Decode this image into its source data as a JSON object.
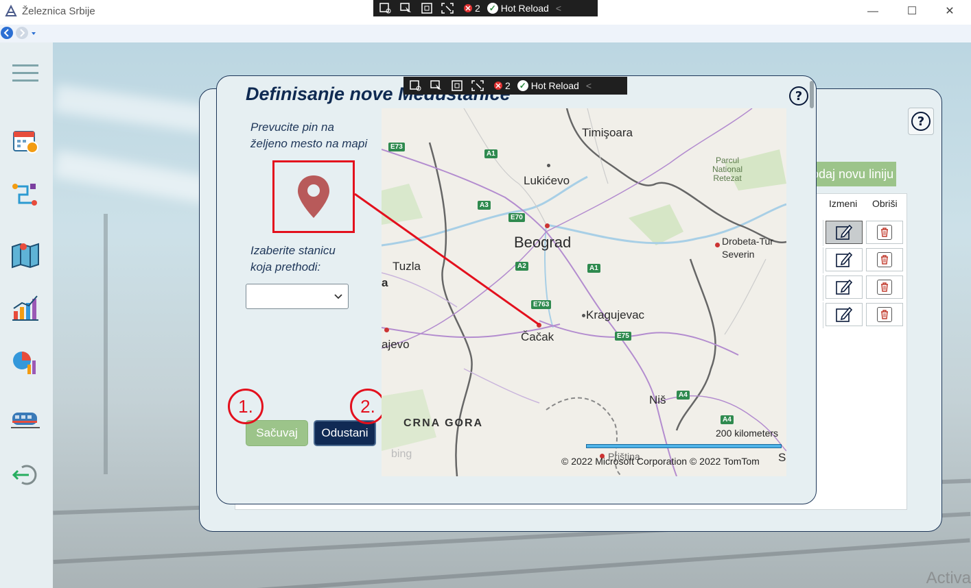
{
  "window": {
    "title": "Železnica Srbije",
    "minimize": "—",
    "maximize": "☐",
    "close": "✕"
  },
  "devbar": {
    "errors": "2",
    "hot_reload": "Hot Reload",
    "collapse": "<"
  },
  "sidebar": {
    "items": [
      "menu-icon",
      "calendar-icon",
      "routes-icon",
      "map-icon",
      "chart-icon",
      "pie-chart-icon",
      "train-icon",
      "logout-icon"
    ]
  },
  "background": {
    "add_line_label": "Dodaj novu liniju",
    "help": "?",
    "columns": {
      "edit": "Izmeni",
      "delete": "Obriši"
    },
    "row_count": 4,
    "watermark": "Activa"
  },
  "dialog": {
    "title": "Definisanje nove Međustanice",
    "help": "?",
    "pin_instruction": [
      "Prevucite pin na",
      "željeno mesto na mapi"
    ],
    "station_label": [
      "Izaberite stanicu",
      "koja prethodi:"
    ],
    "station_select_value": "",
    "save_label": "Sačuvaj",
    "cancel_label": "Odustani",
    "annotations": [
      "1.",
      "2."
    ]
  },
  "map": {
    "cities": {
      "timisoara": "Timişoara",
      "lukicevo": "Lukićevo",
      "beograd": "Beograd",
      "tuzla": "Tuzla",
      "kragujevac": "Kragujevac",
      "cacak": "Čačak",
      "sarajevo": "ajevo",
      "nis": "Niš",
      "drobeta": "Drobeta-Tur",
      "severin": "Severin",
      "pristina": "Priština",
      "a_edge": "a",
      "s_edge": "S"
    },
    "country": "CRNA GORA",
    "park": [
      "Parcul",
      "National",
      "Retezat"
    ],
    "roads": [
      "E73",
      "A1",
      "A3",
      "E70",
      "A2",
      "A1",
      "E763",
      "E75",
      "A4",
      "A4"
    ],
    "scale_label": "200 kilometers",
    "copyright": "© 2022 Microsoft Corporation   © 2022 TomTom",
    "provider": "bing"
  },
  "colors": {
    "accent_navy": "#102a54",
    "save_green": "#9cc48a",
    "annotation_red": "#e3101d",
    "pin": "#b85a5a"
  }
}
